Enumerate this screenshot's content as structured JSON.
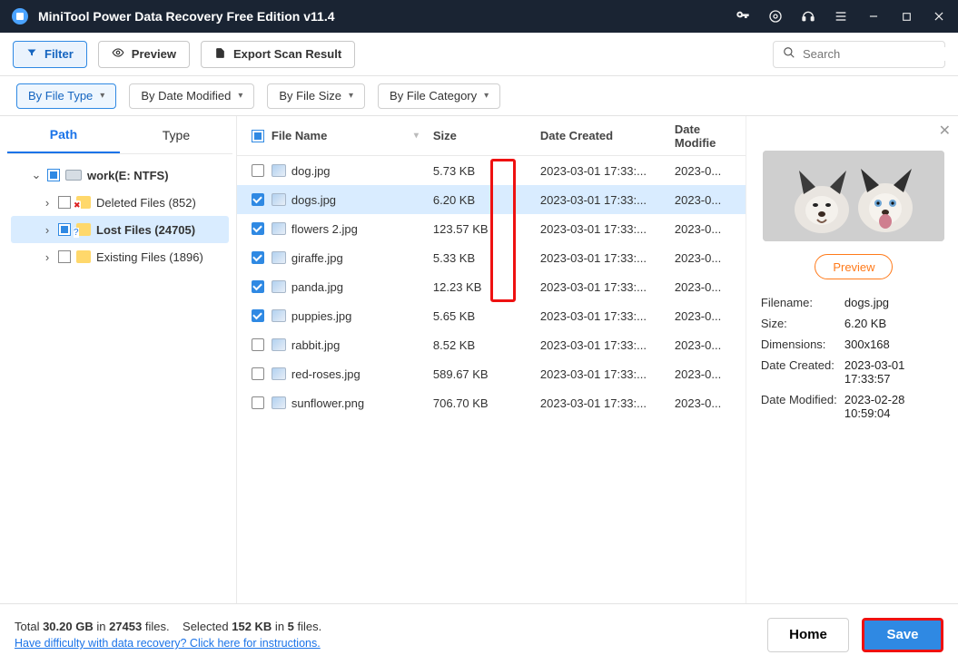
{
  "titlebar": {
    "title": "MiniTool Power Data Recovery Free Edition v11.4"
  },
  "toolbar": {
    "filter": "Filter",
    "preview": "Preview",
    "export": "Export Scan Result",
    "search_placeholder": "Search"
  },
  "chips": {
    "file_type": "By File Type",
    "date_modified": "By Date Modified",
    "file_size": "By File Size",
    "file_category": "By File Category"
  },
  "sidetabs": {
    "path": "Path",
    "type": "Type"
  },
  "tree": {
    "root": "work(E: NTFS)",
    "deleted": "Deleted Files (852)",
    "lost": "Lost Files (24705)",
    "existing": "Existing Files (1896)"
  },
  "columns": {
    "name": "File Name",
    "size": "Size",
    "dc": "Date Created",
    "dm": "Date Modifie"
  },
  "rows": [
    {
      "checked": false,
      "name": "dog.jpg",
      "size": "5.73 KB",
      "dc": "2023-03-01 17:33:...",
      "dm": "2023-0..."
    },
    {
      "checked": true,
      "name": "dogs.jpg",
      "size": "6.20 KB",
      "dc": "2023-03-01 17:33:...",
      "dm": "2023-0...",
      "selected": true
    },
    {
      "checked": true,
      "name": "flowers 2.jpg",
      "size": "123.57 KB",
      "dc": "2023-03-01 17:33:...",
      "dm": "2023-0..."
    },
    {
      "checked": true,
      "name": "giraffe.jpg",
      "size": "5.33 KB",
      "dc": "2023-03-01 17:33:...",
      "dm": "2023-0..."
    },
    {
      "checked": true,
      "name": "panda.jpg",
      "size": "12.23 KB",
      "dc": "2023-03-01 17:33:...",
      "dm": "2023-0..."
    },
    {
      "checked": true,
      "name": "puppies.jpg",
      "size": "5.65 KB",
      "dc": "2023-03-01 17:33:...",
      "dm": "2023-0..."
    },
    {
      "checked": false,
      "name": "rabbit.jpg",
      "size": "8.52 KB",
      "dc": "2023-03-01 17:33:...",
      "dm": "2023-0..."
    },
    {
      "checked": false,
      "name": "red-roses.jpg",
      "size": "589.67 KB",
      "dc": "2023-03-01 17:33:...",
      "dm": "2023-0..."
    },
    {
      "checked": false,
      "name": "sunflower.png",
      "size": "706.70 KB",
      "dc": "2023-03-01 17:33:...",
      "dm": "2023-0..."
    }
  ],
  "details": {
    "preview_btn": "Preview",
    "filename_k": "Filename:",
    "filename_v": "dogs.jpg",
    "size_k": "Size:",
    "size_v": "6.20 KB",
    "dim_k": "Dimensions:",
    "dim_v": "300x168",
    "dc_k": "Date Created:",
    "dc_v": "2023-03-01 17:33:57",
    "dm_k": "Date Modified:",
    "dm_v": "2023-02-28 10:59:04"
  },
  "footer": {
    "total_prefix": "Total ",
    "total_size": "30.20 GB",
    "total_mid": " in ",
    "total_files": "27453",
    "total_suffix": " files.",
    "sel_prefix": "Selected ",
    "sel_size": "152 KB",
    "sel_mid": " in ",
    "sel_count": "5",
    "sel_suffix": " files.",
    "help": "Have difficulty with data recovery? Click here for instructions.",
    "home": "Home",
    "save": "Save"
  }
}
